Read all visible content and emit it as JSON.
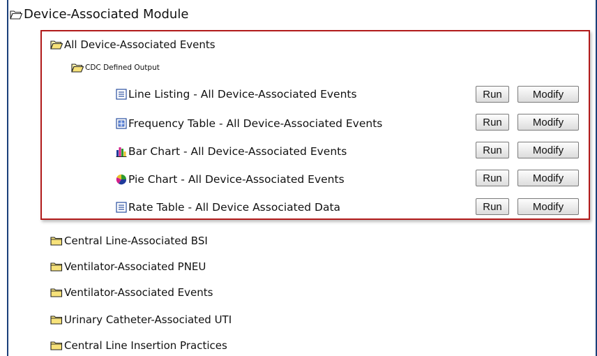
{
  "root": {
    "label": "Device-Associated Module"
  },
  "group": {
    "label": "All Device-Associated Events"
  },
  "subgroup": {
    "label": "CDC Defined Output"
  },
  "reports": [
    {
      "label": "Line Listing - All Device-Associated Events",
      "icon": "line-listing-icon",
      "run_label": "Run",
      "modify_label": "Modify"
    },
    {
      "label": "Frequency Table - All Device-Associated Events",
      "icon": "frequency-table-icon",
      "run_label": "Run",
      "modify_label": "Modify"
    },
    {
      "label": "Bar Chart - All Device-Associated Events",
      "icon": "bar-chart-icon",
      "run_label": "Run",
      "modify_label": "Modify"
    },
    {
      "label": "Pie Chart - All Device-Associated Events",
      "icon": "pie-chart-icon",
      "run_label": "Run",
      "modify_label": "Modify"
    },
    {
      "label": "Rate Table - All Device Associated Data",
      "icon": "rate-table-icon",
      "run_label": "Run",
      "modify_label": "Modify"
    }
  ],
  "folders": [
    {
      "label": "Central Line-Associated BSI"
    },
    {
      "label": "Ventilator-Associated PNEU"
    },
    {
      "label": "Ventilator-Associated Events"
    },
    {
      "label": "Urinary Catheter-Associated UTI"
    },
    {
      "label": "Central Line Insertion Practices"
    }
  ],
  "colors": {
    "highlight_border": "#b11a1a",
    "frame_border": "#1a3f7a",
    "folder_fill": "#f7e27a"
  }
}
